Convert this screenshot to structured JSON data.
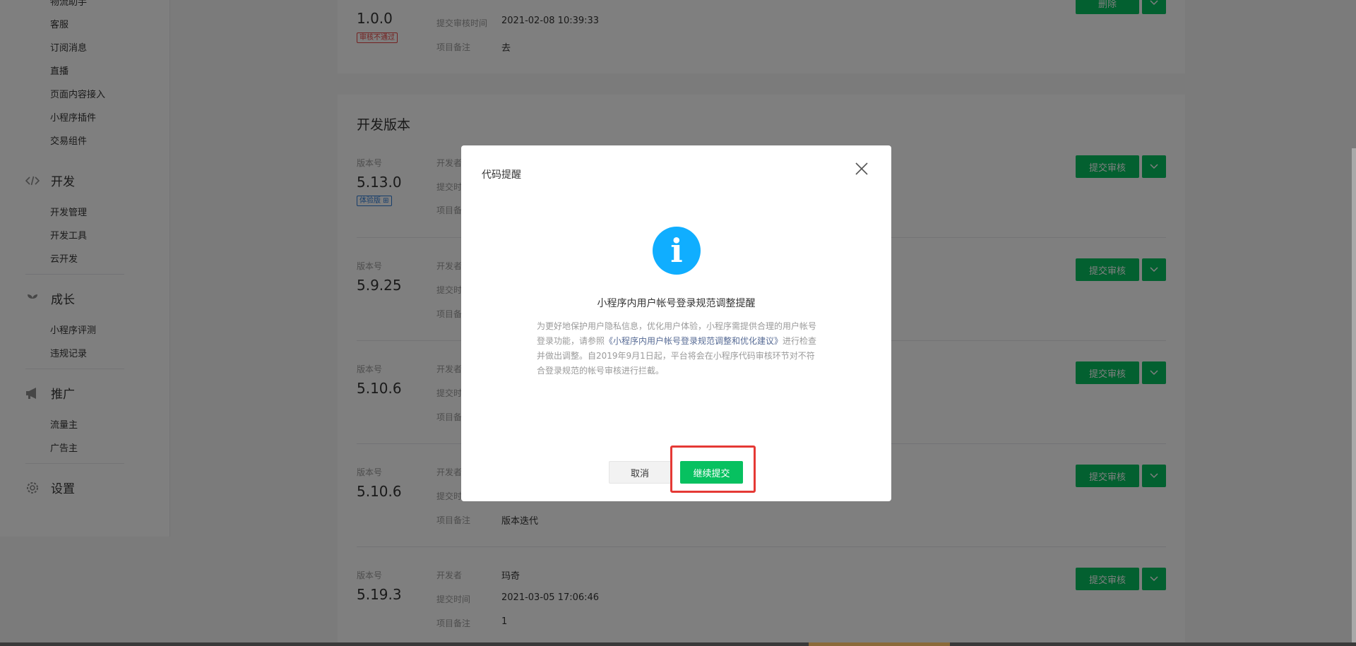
{
  "sidebar": {
    "cut_item": "物流助手",
    "items_group1": [
      "客服",
      "订阅消息",
      "直播",
      "页面内容接入",
      "小程序插件",
      "交易组件"
    ],
    "sections": [
      {
        "label": "开发",
        "icon": "code-icon",
        "items": [
          "开发管理",
          "开发工具",
          "云开发"
        ]
      },
      {
        "label": "成长",
        "icon": "leaf-icon",
        "items": [
          "小程序评测",
          "违规记录"
        ]
      },
      {
        "label": "推广",
        "icon": "megaphone-icon",
        "items": [
          "流量主",
          "广告主"
        ]
      },
      {
        "label": "设置",
        "icon": "gear-icon",
        "items": []
      }
    ]
  },
  "review_version": {
    "version": "1.0.0",
    "badge": "审核不通过",
    "submit_time_label": "提交审核时间",
    "submit_time": "2021-02-08 10:39:33",
    "remark_label": "项目备注",
    "remark": "去",
    "delete_button": "删除"
  },
  "dev_section": {
    "title": "开发版本",
    "labels": {
      "version": "版本号",
      "developer": "开发者",
      "submit_time": "提交时间",
      "remark": "项目备注"
    },
    "submit_button": "提交审核",
    "versions": [
      {
        "version": "5.13.0",
        "badge": "体验版 ⊞",
        "developer": "",
        "submit_time": "",
        "remark": ""
      },
      {
        "version": "5.9.25",
        "developer": "",
        "submit_time": "",
        "remark": ""
      },
      {
        "version": "5.10.6",
        "developer": "",
        "submit_time": "",
        "remark": ""
      },
      {
        "version": "5.10.6",
        "developer": "",
        "submit_time": "",
        "remark": "版本迭代"
      },
      {
        "version": "5.19.3",
        "developer": "玛奇",
        "submit_time": "2021-03-05 17:06:46",
        "remark": "1"
      }
    ]
  },
  "modal": {
    "title": "代码提醒",
    "heading": "小程序内用户帐号登录规范调整提醒",
    "desc_part1": "为更好地保护用户隐私信息，优化用户体验，小程序需提供合理的用户帐号登录功能，请参照",
    "desc_link": "《小程序内用户帐号登录规范调整和优化建议》",
    "desc_part2": "进行检查并做出调整。自2019年9月1日起，平台将会在小程序代码审核环节对不符合登录规范的帐号审核进行拦截。",
    "cancel_button": "取消",
    "continue_button": "继续提交",
    "icon": "info-icon"
  },
  "colors": {
    "primary_green": "#07c160",
    "info_blue": "#10aeff",
    "link": "#576b95",
    "highlight_red": "#e53935"
  }
}
